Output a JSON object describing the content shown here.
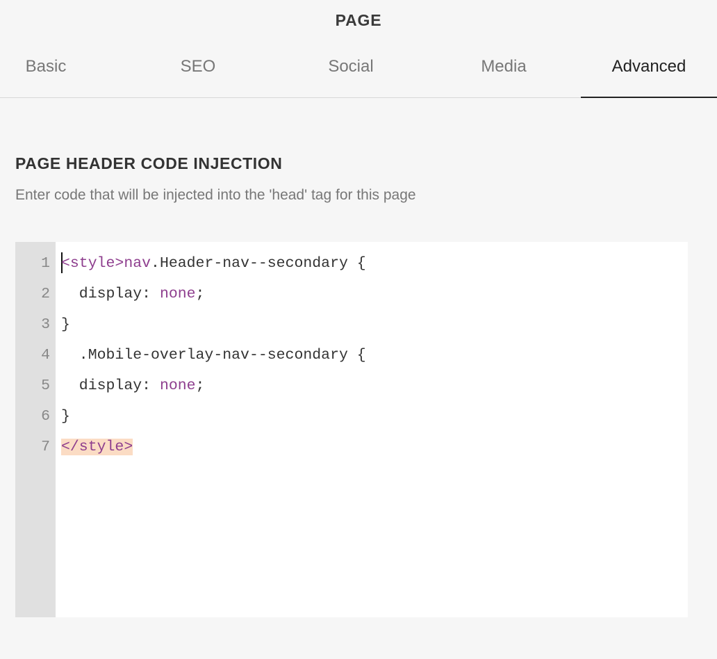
{
  "panel": {
    "title": "PAGE"
  },
  "tabs": [
    {
      "label": "Basic",
      "active": false
    },
    {
      "label": "SEO",
      "active": false
    },
    {
      "label": "Social",
      "active": false
    },
    {
      "label": "Media",
      "active": false
    },
    {
      "label": "Advanced",
      "active": true
    }
  ],
  "section": {
    "heading": "PAGE HEADER CODE INJECTION",
    "description": "Enter code that will be injected into the 'head' tag for this page"
  },
  "editor": {
    "line_numbers": [
      "1",
      "2",
      "3",
      "4",
      "5",
      "6",
      "7"
    ],
    "lines": {
      "l1_open_tag": "<style>",
      "l1_selector_el": "nav",
      "l1_rest": ".Header-nav--secondary {",
      "l2_prop": "  display: ",
      "l2_value": "none",
      "l2_end": ";",
      "l3": "}",
      "l4": "  .Mobile-overlay-nav--secondary {",
      "l5_prop": "  display: ",
      "l5_value": "none",
      "l5_end": ";",
      "l6": "}",
      "l7_close_tag": "</style>"
    }
  }
}
